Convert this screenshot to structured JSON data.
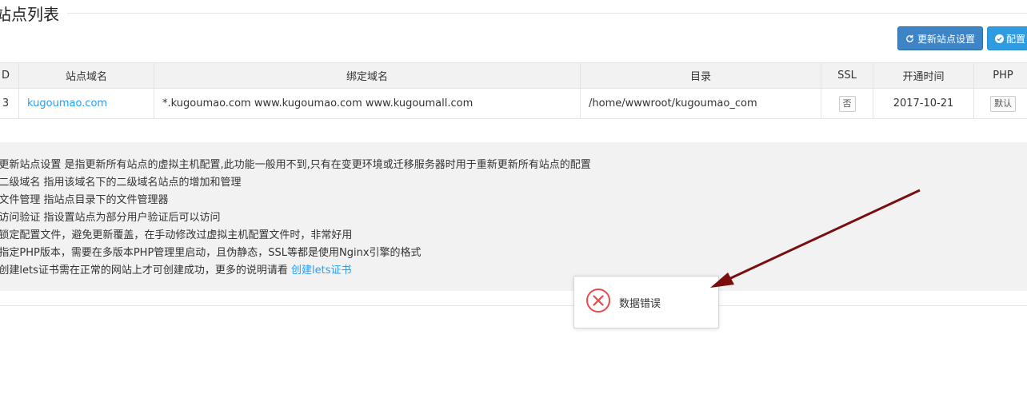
{
  "section": {
    "title": "站点列表"
  },
  "toolbar": {
    "rebuild_label": "更新站点设置",
    "config_label": "配置"
  },
  "table": {
    "headers": {
      "id": "D",
      "domain": "站点域名",
      "bind": "绑定域名",
      "dir": "目录",
      "ssl": "SSL",
      "time": "开通时间",
      "php": "PHP"
    },
    "rows": [
      {
        "id": "3",
        "domain": "kugoumao.com",
        "bind": "*.kugoumao.com www.kugoumao.com www.kugoumall.com",
        "dir": "/home/wwwroot/kugoumao_com",
        "ssl": "否",
        "time": "2017-10-21",
        "php": "默认"
      }
    ]
  },
  "help": {
    "items": [
      ":更新站点设置 是指更新所有站点的虚拟主机配置,此功能一般用不到,只有在变更环境或迁移服务器时用于重新更新所有站点的配置",
      ":二级域名 指用该域名下的二级域名站点的增加和管理",
      ":文件管理 指站点目录下的文件管理器",
      ":访问验证 指设置站点为部分用户验证后可以访问",
      ":锁定配置文件，避免更新覆盖，在手动修改过虚拟主机配置文件时，非常好用",
      ":指定PHP版本，需要在多版本PHP管理里启动，且伪静态，SSL等都是使用Nginx引擎的格式"
    ],
    "last_text": ":创建lets证书需在正常的网站上才可创建成功，更多的说明请看 ",
    "last_link": "创建lets证书"
  },
  "toast": {
    "message": "数据错误"
  },
  "colors": {
    "primary": "#3e85c7",
    "link": "#20a0ff",
    "error": "#e64c4c",
    "arrow": "#7a0e0e"
  }
}
